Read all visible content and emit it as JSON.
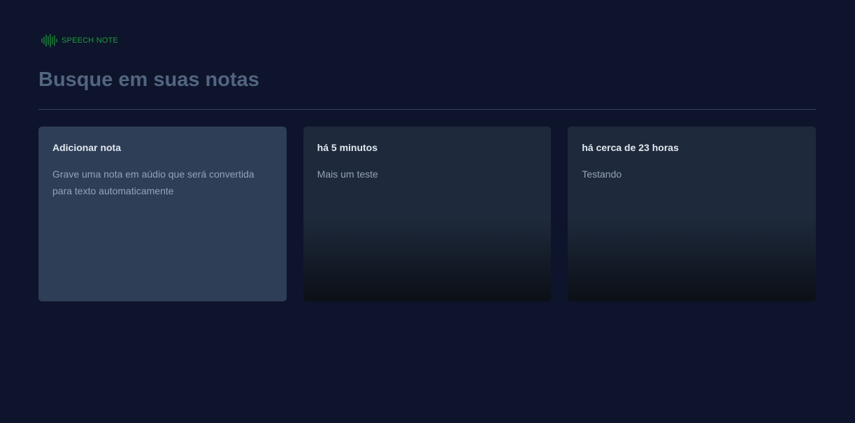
{
  "logo": {
    "text": "SPEECH NOTE",
    "icon": "sound-wave-icon",
    "color": "#1f9d3c"
  },
  "search": {
    "placeholder": "Busque em suas notas",
    "value": ""
  },
  "add_card": {
    "title": "Adicionar nota",
    "description": "Grave uma nota em aúdio que será convertida para texto automaticamente"
  },
  "notes": [
    {
      "time": "há 5 minutos",
      "content": "Mais um teste"
    },
    {
      "time": "há cerca de 23 horas",
      "content": "Testando"
    }
  ],
  "colors": {
    "background": "#0e142b",
    "add_card": "#2e3e56",
    "note_card": "#1e293b",
    "accent": "#1f9d3c"
  }
}
